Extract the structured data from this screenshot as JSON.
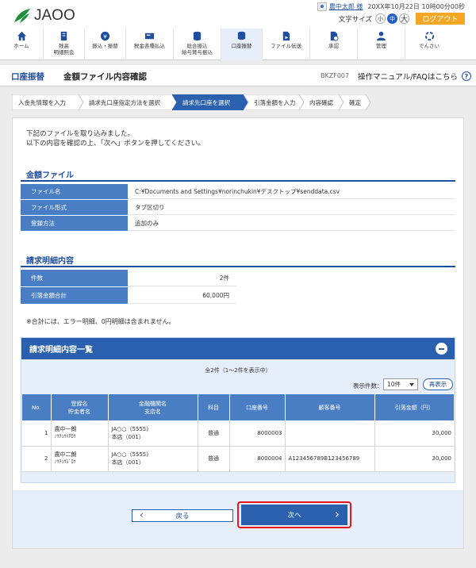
{
  "header": {
    "logo_text": "JAOO",
    "user_name": "農中太郎 様",
    "datetime": "20XX年10月22日 10時00分00秒",
    "font_size_label": "文字サイズ",
    "font_small": "小",
    "font_medium": "中",
    "font_large": "大",
    "logout_label": "ログアウト",
    "brand_color": "#1e5fc2",
    "logout_color": "#f5a623"
  },
  "nav": [
    {
      "label": "ホーム",
      "icon": "home-icon"
    },
    {
      "label": "残高\n明細照会",
      "icon": "balance-icon"
    },
    {
      "label": "振込・振替",
      "icon": "transfer-icon"
    },
    {
      "label": "税金各種払込",
      "icon": "tax-icon"
    },
    {
      "label": "総合振込\n給与賞与振込",
      "icon": "bulk-transfer-icon"
    },
    {
      "label": "口座振替",
      "icon": "account-transfer-icon"
    },
    {
      "label": "ファイル伝送",
      "icon": "file-transfer-icon"
    },
    {
      "label": "承認",
      "icon": "approval-icon"
    },
    {
      "label": "管理",
      "icon": "admin-icon"
    },
    {
      "label": "でんさい",
      "icon": "densai-icon"
    }
  ],
  "title": {
    "category": "口座振替",
    "page": "金額ファイル内容確認",
    "screen_id": "BKZF007",
    "help": "操作マニュアル/FAQはこちら"
  },
  "steps": [
    "入金先情報を入力",
    "請求先口座指定方法を選択",
    "請求先口座を選択",
    "引落金額を入力",
    "内容確認",
    "確定"
  ],
  "intro": {
    "line1": "下記のファイルを取り込みました。",
    "line2": "以下の内容を確認の上、「次へ」ボタンを押してください。"
  },
  "file": {
    "heading": "金額ファイル",
    "name_label": "ファイル名",
    "name_value": "C:¥Documents and Settings¥norinchukin¥デスクトップ¥senddata.csv",
    "format_label": "ファイル形式",
    "format_value": "タブ区切り",
    "method_label": "登録方法",
    "method_value": "追加のみ"
  },
  "summary": {
    "heading": "請求明細内容",
    "count_label": "件数",
    "count_value": "2件",
    "total_label": "引落金額合計",
    "total_value": "60,000円",
    "note": "※合計には、エラー明細、0円明細は含まれません。"
  },
  "list": {
    "heading": "請求明細内容一覧",
    "count_text": "全2件（1～2件を表示中）",
    "per_page_label": "表示件数：",
    "per_page_value": "10件",
    "redisplay": "再表示",
    "headers": {
      "no": "No.",
      "name1": "登録名",
      "name2": "貯金者名",
      "bank1": "金融機関名",
      "bank2": "支店名",
      "type": "科目",
      "account": "口座番号",
      "customer": "顧客番号",
      "amount": "引落金額（円）"
    },
    "rows": [
      {
        "no": "1",
        "name": "農中一朗",
        "kana": "ﾉｳﾁｭｳｲﾁﾛｳ",
        "bank": "JA○○（5555）",
        "branch": "本店（001）",
        "type": "普通",
        "account": "8000003",
        "customer": "",
        "amount": "30,000"
      },
      {
        "no": "2",
        "name": "農中二朗",
        "kana": "ﾉｳﾁｭｳｼﾞﾛｳ",
        "bank": "JA○○（5555）",
        "branch": "本店（001）",
        "type": "普通",
        "account": "8000004",
        "customer": "A123456789B123456789",
        "amount": "30,000"
      }
    ]
  },
  "buttons": {
    "back": "戻る",
    "next": "次へ"
  }
}
